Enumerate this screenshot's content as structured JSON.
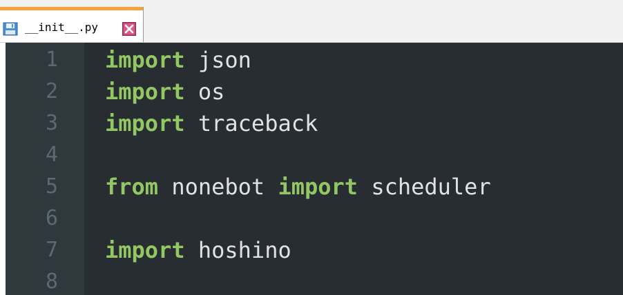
{
  "tab": {
    "label": "__init__.py",
    "file_icon": "floppy-disk-icon",
    "close_icon": "close-icon",
    "accent_color": "#f7a23d",
    "close_color": "#c0396b"
  },
  "editor": {
    "background_color": "#272d31",
    "gutter_color": "#2f383c",
    "keyword_color": "#93c763",
    "text_color": "#e0e2e4",
    "line_number_color": "#5c6a70",
    "line_numbers": [
      "1",
      "2",
      "3",
      "4",
      "5",
      "6",
      "7",
      "8"
    ],
    "lines": [
      {
        "kw1": "import",
        "text1": " json",
        "kw2": "",
        "text2": ""
      },
      {
        "kw1": "import",
        "text1": " os",
        "kw2": "",
        "text2": ""
      },
      {
        "kw1": "import",
        "text1": " traceback",
        "kw2": "",
        "text2": ""
      },
      {
        "kw1": "",
        "text1": "",
        "kw2": "",
        "text2": ""
      },
      {
        "kw1": "from",
        "text1": " nonebot ",
        "kw2": "import",
        "text2": " scheduler"
      },
      {
        "kw1": "",
        "text1": "",
        "kw2": "",
        "text2": ""
      },
      {
        "kw1": "import",
        "text1": " hoshino",
        "kw2": "",
        "text2": ""
      },
      {
        "kw1": "",
        "text1": "",
        "kw2": "",
        "text2": ""
      }
    ]
  }
}
